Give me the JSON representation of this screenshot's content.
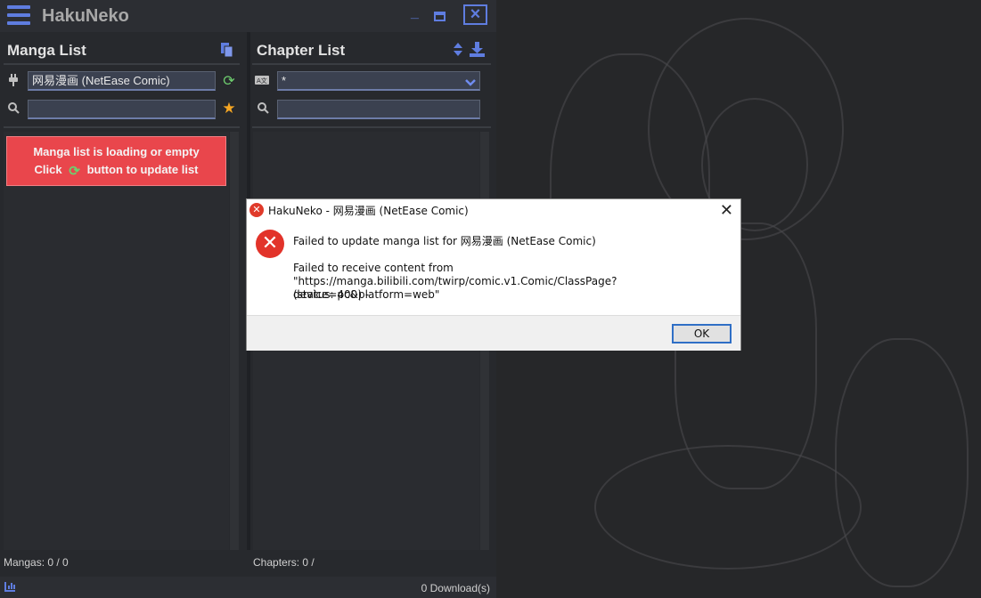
{
  "app": {
    "title": "HakuNeko"
  },
  "manga_panel": {
    "title": "Manga List",
    "connector_value": "网易漫画 (NetEase Comic)",
    "search_value": "",
    "error_line1": "Manga list is loading or empty",
    "error_line2_prefix": "Click",
    "error_line2_suffix": "button to update list",
    "status": "Mangas: 0 / 0"
  },
  "chapter_panel": {
    "title": "Chapter List",
    "language_value": "*",
    "search_value": "",
    "status": "Chapters: 0 /"
  },
  "footer": {
    "downloads": "0 Download(s)"
  },
  "dialog": {
    "title": "HakuNeko - 网易漫画 (NetEase Comic)",
    "message": "Failed to update manga list for 网易漫画 (NetEase Comic)",
    "detail_line1": "Failed to receive content from",
    "detail_line2": "\"https://manga.bilibili.com/twirp/comic.v1.Comic/ClassPage?device=pc&platform=web\"",
    "detail_line3": "(status: 400) -",
    "ok_label": "OK"
  },
  "colors": {
    "accent": "#5f7de0",
    "error": "#e9464c",
    "refresh": "#6fcf6f",
    "star": "#f5a623"
  }
}
